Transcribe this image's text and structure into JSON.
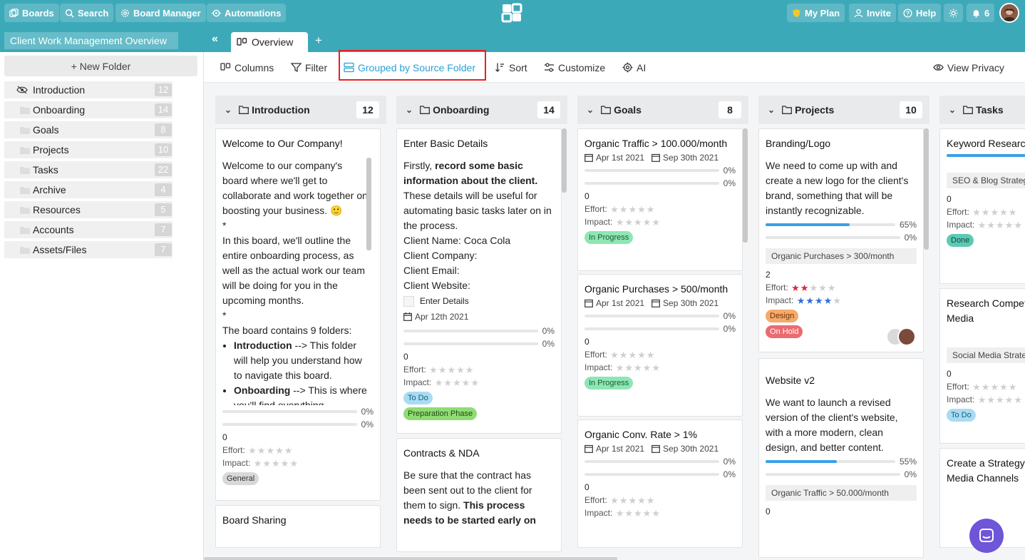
{
  "topbar": {
    "boards": "Boards",
    "search": "Search",
    "board_manager": "Board Manager",
    "automations": "Automations",
    "my_plan": "My Plan",
    "invite": "Invite",
    "help": "Help",
    "notifications_count": "6"
  },
  "tabbar": {
    "board_title": "Client Work Management Overview",
    "collapse": "«",
    "tab_overview": "Overview",
    "add_tab": "+"
  },
  "sidebar": {
    "new_folder": "+ New Folder",
    "folders": [
      {
        "name": "Introduction",
        "count": "12"
      },
      {
        "name": "Onboarding",
        "count": "14"
      },
      {
        "name": "Goals",
        "count": "8"
      },
      {
        "name": "Projects",
        "count": "10"
      },
      {
        "name": "Tasks",
        "count": "22"
      },
      {
        "name": "Archive",
        "count": "4"
      },
      {
        "name": "Resources",
        "count": "5"
      },
      {
        "name": "Accounts",
        "count": "7"
      },
      {
        "name": "Assets/Files",
        "count": "7"
      }
    ]
  },
  "toolbar": {
    "columns": "Columns",
    "filter": "Filter",
    "grouped": "Grouped by Source Folder",
    "sort": "Sort",
    "customize": "Customize",
    "ai": "AI",
    "view_privacy": "View Privacy"
  },
  "colors": {
    "brand": "#3ca9b9",
    "active": "#2aa0d6",
    "highlight": "#e02424",
    "chat": "#6f55d8"
  },
  "labels": {
    "effort": "Effort:",
    "impact": "Impact:",
    "zero_pct": "0%",
    "zero": "0"
  },
  "columns": [
    {
      "name": "Introduction",
      "count": "12"
    },
    {
      "name": "Onboarding",
      "count": "14"
    },
    {
      "name": "Goals",
      "count": "8"
    },
    {
      "name": "Projects",
      "count": "10"
    },
    {
      "name": "Tasks",
      "count": ""
    }
  ],
  "intro": {
    "card1_title": "Welcome to Our Company!",
    "p1": "Welcome to our company's board where we'll get to collaborate and work together on boosting your business. 🙂",
    "star1": "*",
    "p2": "In this board, we'll outline the entire onboarding process, as well as the actual work our team will be doing for you in the upcoming months.",
    "star2": "*",
    "p3": "The board contains 9 folders:",
    "li1_bold": "Introduction",
    "li1_text": " --> This folder will help you understand how to navigate this board.",
    "li2_bold": "Onboarding",
    "li2_text": " --> This is where you'll find everything",
    "badge": "General",
    "card2_title": "Board Sharing"
  },
  "onboarding": {
    "card1_title": "Enter Basic Details",
    "firstly": "Firstly, ",
    "bold1": "record some basic information about the client.",
    "p1": " These details will be useful for automating basic tasks later on in the process.",
    "client_name": "Client Name: Coca Cola",
    "client_company": "Client Company:",
    "client_email": "Client Email:",
    "client_website": "Client Website:",
    "checkbox_label": "Enter Details",
    "date": "Apr 12th 2021",
    "badge1": "To Do",
    "badge2": "Preparation Phase",
    "card2_title": "Contracts & NDA",
    "card2_p": "Be sure that the contract has been sent out to the client for them to sign. ",
    "card2_bold": "This process needs to be started early on"
  },
  "goals": {
    "card1_title": "Organic Traffic > 100.000/month",
    "card1_start": "Apr 1st 2021",
    "card1_end": "Sep 30th 2021",
    "card1_badge": "In Progress",
    "card2_title": "Organic Purchases > 500/month",
    "card2_start": "Apr 1st 2021",
    "card2_end": "Sep 30th 2021",
    "card2_badge": "In Progress",
    "card3_title": "Organic Conv. Rate > 1%",
    "card3_start": "Apr 1st 2021",
    "card3_end": "Sep 30th 2021"
  },
  "projects": {
    "card1_title": "Branding/Logo",
    "card1_p": "We need to come up with and create a new logo for the client's brand, something that will be instantly recognizable.",
    "card1_pct": "65%",
    "card1_progress": 0.65,
    "card1_tag": "Organic Purchases > 300/month",
    "card1_num": "2",
    "card1_effort": 2,
    "card1_impact": 4,
    "card1_badge1": "Design",
    "card1_badge2": "On Hold",
    "card2_title": "Website v2",
    "card2_p": "We want to launch a revised version of the client's website, with a more modern, clean design, and better content.",
    "card2_pct": "55%",
    "card2_progress": 0.55,
    "card2_tag": "Organic Traffic > 50.000/month"
  },
  "tasks": {
    "card1_title": "Keyword Research Blog Strategy",
    "card1_tag": "SEO & Blog Strategy",
    "card1_badge": "Done",
    "card2_title": "Research Competitors Social Media",
    "card2_tag": "Social Media Strategy",
    "card2_badge": "To Do",
    "card3_title": "Create a Strategy for Social Media Channels"
  }
}
